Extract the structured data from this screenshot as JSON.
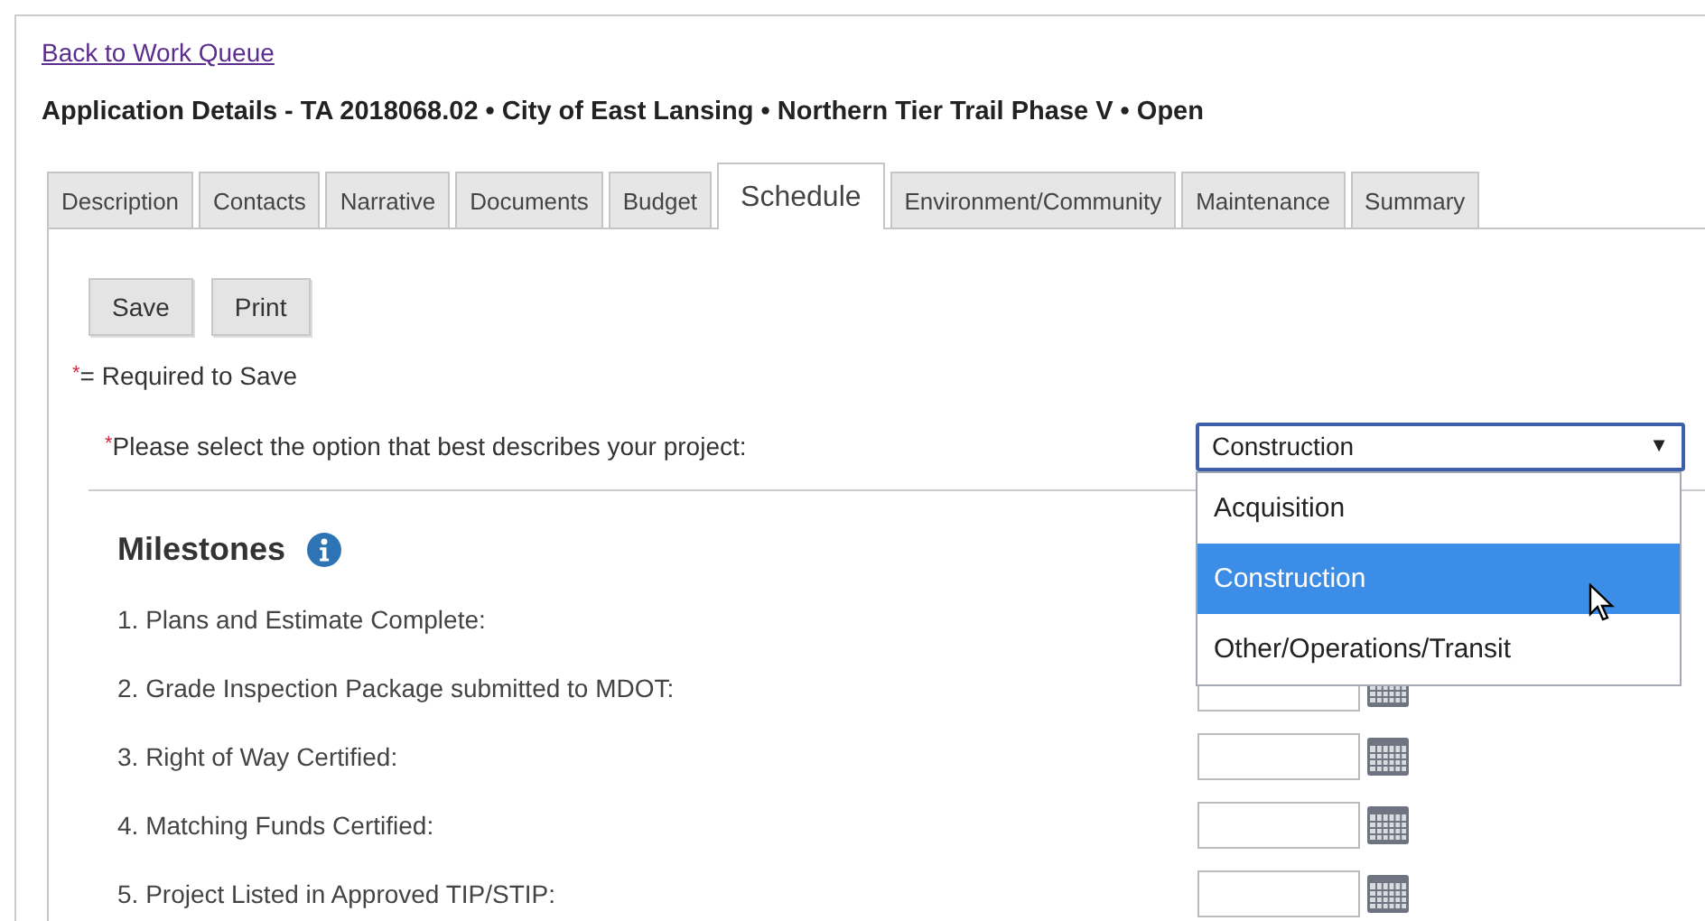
{
  "back_link": "Back to Work Queue",
  "title": "Application Details - TA 2018068.02 • City of East Lansing • Northern Tier Trail Phase V • Open",
  "tabs": [
    {
      "label": "Description",
      "selected": false
    },
    {
      "label": "Contacts",
      "selected": false
    },
    {
      "label": "Narrative",
      "selected": false
    },
    {
      "label": "Documents",
      "selected": false
    },
    {
      "label": "Budget",
      "selected": false
    },
    {
      "label": "Schedule",
      "selected": true
    },
    {
      "label": "Environment/Community",
      "selected": false
    },
    {
      "label": "Maintenance",
      "selected": false
    },
    {
      "label": "Summary",
      "selected": false
    }
  ],
  "buttons": [
    "Save",
    "Print"
  ],
  "required_note": {
    "mark": "*",
    "text": "= Required to Save"
  },
  "project_type": {
    "mark": "*",
    "label": "Please select the option that best describes your project:",
    "value": "Construction",
    "arrow": "▼",
    "expanded": true,
    "options": [
      {
        "label": "Acquisition",
        "selected": false
      },
      {
        "label": "Construction",
        "selected": true
      },
      {
        "label": "Other/Operations/Transit",
        "selected": false
      }
    ]
  },
  "milestones": {
    "heading": "Milestones",
    "items": [
      {
        "label": "1. Plans and Estimate Complete:",
        "kind": "covered"
      },
      {
        "label": "2. Grade Inspection Package submitted to MDOT:",
        "kind": "date"
      },
      {
        "label": "3. Right of Way Certified:",
        "kind": "date"
      },
      {
        "label": "4. Matching Funds Certified:",
        "kind": "date"
      },
      {
        "label": "5. Project Listed in Approved TIP/STIP:",
        "kind": "date"
      }
    ]
  }
}
